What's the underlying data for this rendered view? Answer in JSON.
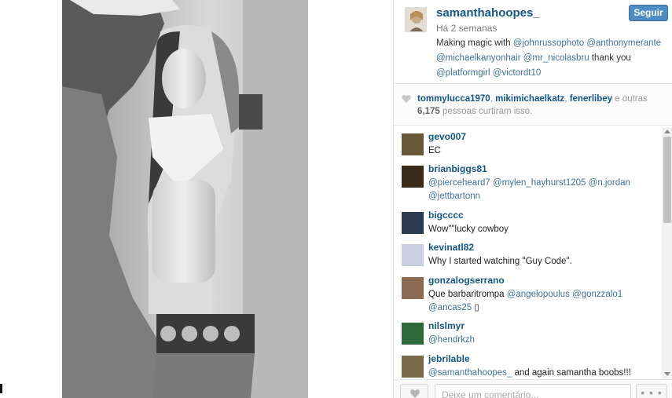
{
  "post": {
    "username": "samanthahoopes_",
    "follow_label": "Seguir",
    "time": "Há 2 semanas",
    "caption": [
      {
        "text": "Making magic with ",
        "mention": false
      },
      {
        "text": "@johnrussophoto",
        "mention": true
      },
      {
        "text": " ",
        "mention": false
      },
      {
        "text": "@anthonymerante",
        "mention": true
      },
      {
        "text": " ",
        "mention": false
      },
      {
        "text": "@michaelkanyonhair",
        "mention": true
      },
      {
        "text": " ",
        "mention": false
      },
      {
        "text": "@mr_nicolasbru",
        "mention": true
      },
      {
        "text": " thank you ",
        "mention": false
      },
      {
        "text": "@platformgirl",
        "mention": true
      },
      {
        "text": " ",
        "mention": false
      },
      {
        "text": "@victordt10",
        "mention": true
      }
    ]
  },
  "likes": {
    "names": [
      "tommylucca1970",
      "mikimichaelkatz",
      "fenerlibey"
    ],
    "and_others": "e outras",
    "count": "6,175",
    "suffix": "pessoas curtiram isso."
  },
  "comments": [
    {
      "user": "gevo007",
      "parts": [
        {
          "text": "EC",
          "mention": false
        }
      ],
      "avatar_color": "#6b5a3a"
    },
    {
      "user": "brianbiggs81",
      "parts": [
        {
          "text": "@pierceheard7",
          "mention": true
        },
        {
          "text": " ",
          "mention": false
        },
        {
          "text": "@mylen_hayhurst1205",
          "mention": true
        },
        {
          "text": " ",
          "mention": false
        },
        {
          "text": "@n.jordan",
          "mention": true
        },
        {
          "text": " ",
          "mention": false
        },
        {
          "text": "@jettbartonn",
          "mention": true
        }
      ],
      "avatar_color": "#3a2a1a"
    },
    {
      "user": "bigcccc",
      "parts": [
        {
          "text": "Wow\"\"lucky cowboy",
          "mention": false
        }
      ],
      "avatar_color": "#2d3b52"
    },
    {
      "user": "kevinatl82",
      "parts": [
        {
          "text": "Why I started watching \"Guy Code\".",
          "mention": false
        }
      ],
      "avatar_color": "#c9cfe0"
    },
    {
      "user": "gonzalogserrano",
      "parts": [
        {
          "text": "Que barbaritrompa ",
          "mention": false
        },
        {
          "text": "@angelopoulus",
          "mention": true
        },
        {
          "text": " ",
          "mention": false
        },
        {
          "text": "@gonzzalo1",
          "mention": true
        },
        {
          "text": " ",
          "mention": false
        },
        {
          "text": "@ancas25",
          "mention": true
        },
        {
          "text": " ▯",
          "mention": false
        }
      ],
      "avatar_color": "#8a6a52"
    },
    {
      "user": "nilslmyr",
      "parts": [
        {
          "text": "@hendrkzh",
          "mention": true
        }
      ],
      "avatar_color": "#2f6a3a"
    },
    {
      "user": "jebrilable",
      "parts": [
        {
          "text": "@samanthahoopes_",
          "mention": true
        },
        {
          "text": " and again samantha boobs!!!",
          "mention": false
        }
      ],
      "avatar_color": "#7a6a4a"
    }
  ],
  "footer": {
    "comment_placeholder": "Deixe um comentário...",
    "more_label": "• • •"
  },
  "colors": {
    "link": "#125688",
    "mention": "#3f729b",
    "follow_button": "#4e8cc4"
  }
}
